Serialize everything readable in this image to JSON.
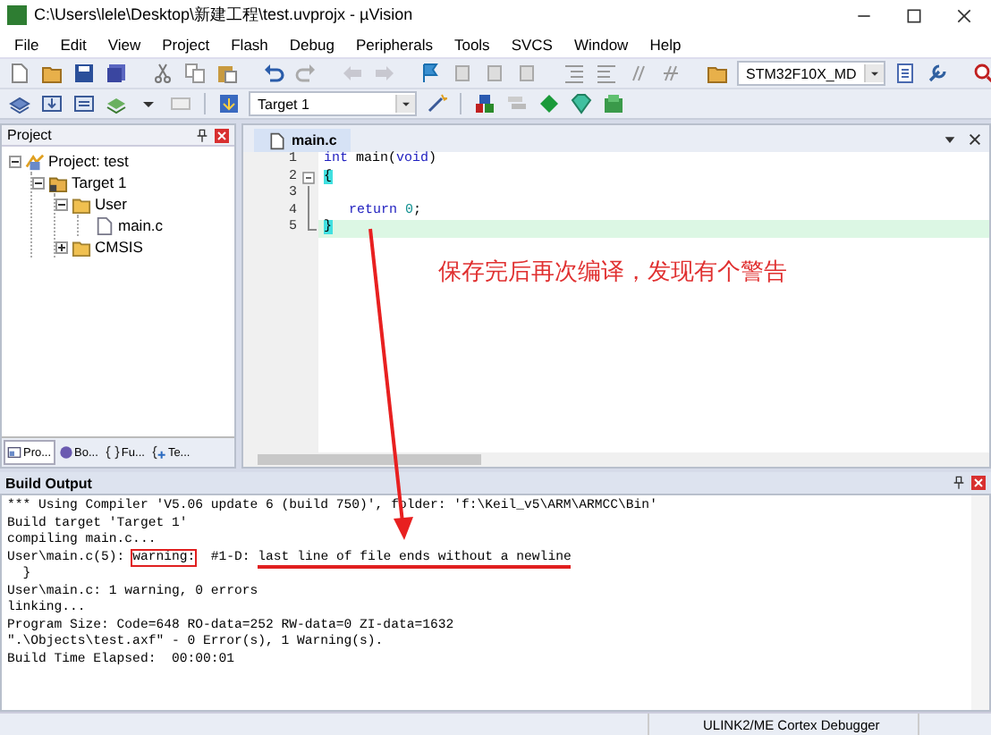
{
  "window": {
    "title": "C:\\Users\\lele\\Desktop\\新建工程\\test.uvprojx - µVision"
  },
  "menu": [
    "File",
    "Edit",
    "View",
    "Project",
    "Flash",
    "Debug",
    "Peripherals",
    "Tools",
    "SVCS",
    "Window",
    "Help"
  ],
  "toolbar": {
    "device": "STM32F10X_MD",
    "target": "Target 1"
  },
  "project_panel": {
    "title": "Project",
    "tree": [
      {
        "label": "Project: test",
        "kind": "project",
        "expanded": true,
        "children": [
          {
            "label": "Target 1",
            "kind": "target",
            "expanded": true,
            "children": [
              {
                "label": "User",
                "kind": "folder",
                "expanded": true,
                "children": [
                  {
                    "label": "main.c",
                    "kind": "file"
                  }
                ]
              },
              {
                "label": "CMSIS",
                "kind": "folder",
                "expanded": false
              }
            ]
          }
        ]
      }
    ],
    "tabs": [
      {
        "label": "Pro...",
        "kind": "project",
        "selected": true
      },
      {
        "label": "Bo...",
        "kind": "books",
        "selected": false
      },
      {
        "label": "Fu...",
        "kind": "functions",
        "selected": false
      },
      {
        "label": "Te...",
        "kind": "templates",
        "selected": false
      }
    ]
  },
  "editor": {
    "tab": "main.c",
    "lines": [
      {
        "number": "1",
        "kind": "plain",
        "current": false,
        "indented": false,
        "tokens": [
          {
            "kind": "keyword",
            "text": "int"
          },
          {
            "kind": "plain",
            "text": " main("
          },
          {
            "kind": "keyword",
            "text": "void"
          },
          {
            "kind": "plain",
            "text": ")"
          }
        ]
      },
      {
        "number": "2",
        "kind": "fold_start",
        "current": false,
        "indented": false,
        "tokens": [
          {
            "kind": "brace",
            "text": "{"
          }
        ]
      },
      {
        "number": "3",
        "kind": "fold_line",
        "current": false
      },
      {
        "number": "4",
        "kind": "fold_line",
        "current": false,
        "indented": true,
        "tokens": [
          {
            "kind": "keyword",
            "text": "return"
          },
          {
            "kind": "number",
            "text": " 0"
          },
          {
            "kind": "plain",
            "text": ";"
          }
        ]
      },
      {
        "number": "5",
        "kind": "fold_end",
        "current": true,
        "indented": false,
        "tokens": [
          {
            "kind": "brace",
            "text": "}"
          }
        ]
      }
    ]
  },
  "annotation": "保存完后再次编译，发现有个警告",
  "build_output": {
    "title": "Build Output",
    "lines": [
      {
        "kind": "plain",
        "text": "*** Using Compiler 'V5.06 update 6 (build 750)', folder: 'f:\\Keil_v5\\ARM\\ARMCC\\Bin'"
      },
      {
        "kind": "plain",
        "text": "Build target 'Target 1'"
      },
      {
        "kind": "plain",
        "text": "compiling main.c..."
      },
      {
        "kind": "warning",
        "location": "User\\main.c(5):",
        "label": "warning:",
        "code": "#1-D:",
        "message": "last line of file ends without a newline"
      },
      {
        "kind": "plain",
        "text": "  }"
      },
      {
        "kind": "plain",
        "text": "User\\main.c: 1 warning, 0 errors"
      },
      {
        "kind": "plain",
        "text": "linking..."
      },
      {
        "kind": "plain",
        "text": "Program Size: Code=648 RO-data=252 RW-data=0 ZI-data=1632"
      },
      {
        "kind": "plain",
        "text": "\".\\Objects\\test.axf\" - 0 Error(s), 1 Warning(s)."
      },
      {
        "kind": "plain",
        "text": "Build Time Elapsed:  00:00:01"
      }
    ]
  },
  "status_bar": {
    "debugger": "ULINK2/ME Cortex Debugger"
  }
}
